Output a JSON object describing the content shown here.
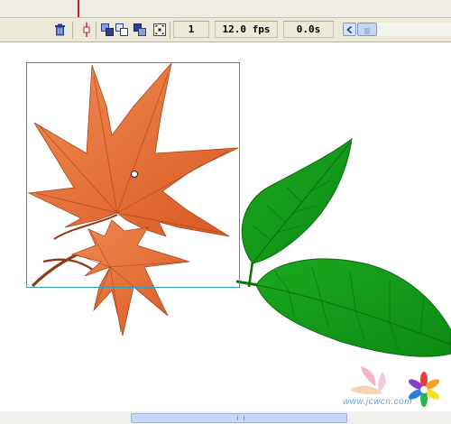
{
  "status_bar": {
    "frame": "1",
    "fps": "12.0 fps",
    "elapsed": "0.0s"
  },
  "icons": {
    "trash": "trash-icon",
    "onion_skin": "onion-skin-icon",
    "onion_outlines": "onion-skin-outlines-icon",
    "edit_multiple": "edit-multiple-frames-icon",
    "onion_markers": "modify-onion-markers-icon",
    "scroll_left": "chevron-left-icon"
  },
  "stage": {
    "watermark_text": "www.jcwcn.com"
  },
  "colors": {
    "maple_fill": "#e0692e",
    "maple_vein": "#b6441b",
    "leaf_fill": "#129c16",
    "leaf_dark": "#0b7a10",
    "selection_border": "#2b9fc0",
    "status_bar_bg": "#ece9d8"
  }
}
